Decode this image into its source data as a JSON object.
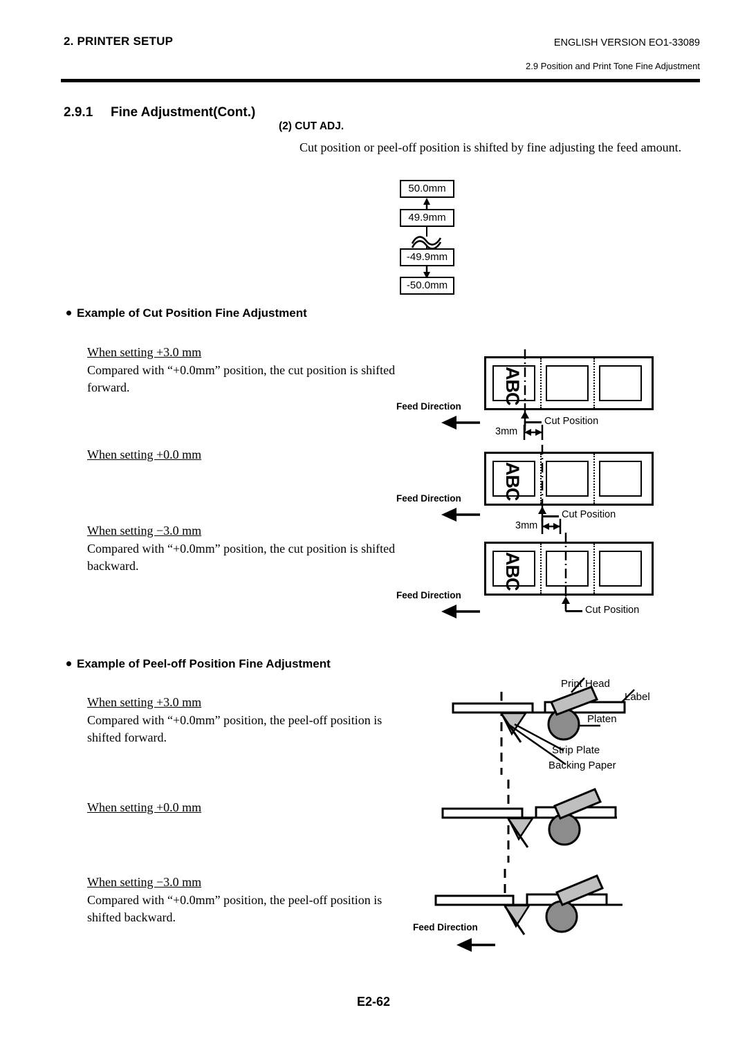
{
  "header": {
    "chapter": "2. PRINTER SETUP",
    "version": "ENGLISH VERSION EO1-33089",
    "subsection": "2.9 Position and Print Tone Fine Adjustment"
  },
  "section": {
    "number": "2.9.1",
    "title": "Fine Adjustment(Cont.)",
    "item_heading": "(2) CUT ADJ.",
    "item_body": "Cut position or peel-off position is shifted by fine adjusting the feed amount."
  },
  "range_boxes": {
    "max": "50.0mm",
    "near_max": "49.9mm",
    "near_min": "-49.9mm",
    "min": "-50.0mm"
  },
  "cut_section": {
    "heading": "Example of Cut Position Fine Adjustment",
    "cases": [
      {
        "setting": "When setting +3.0 mm",
        "line1": "Compared with “+0.0mm” position, the cut position",
        "line2": "is shifted forward."
      },
      {
        "setting": "When setting +0.0 mm",
        "line1": "",
        "line2": ""
      },
      {
        "setting": "When setting −3.0 mm",
        "line1": "Compared with “+0.0mm” position, the cut position",
        "line2": "is shifted backward."
      }
    ],
    "diagram_labels": {
      "feed_direction": "Feed Direction",
      "cut_position": "Cut Position",
      "dimension": "3mm",
      "label_text": "ABC"
    }
  },
  "peel_section": {
    "heading": "Example of Peel-off Position Fine Adjustment",
    "cases": [
      {
        "setting": "When setting +3.0 mm",
        "line1": "Compared with “+0.0mm” position, the peel-off",
        "line2": "position is shifted forward."
      },
      {
        "setting": "When setting +0.0 mm",
        "line1": "",
        "line2": ""
      },
      {
        "setting": "When setting −3.0 mm",
        "line1": "Compared with “+0.0mm” position, the peel-off",
        "line2": "position is shifted backward."
      }
    ],
    "diagram_labels": {
      "print_head": "Print Head",
      "label": "Label",
      "platen": "Platen",
      "strip_plate": "Strip Plate",
      "backing_paper": "Backing Paper",
      "feed_direction": "Feed Direction"
    }
  },
  "footer": {
    "page": "E2-62"
  },
  "colors": {
    "ink": "#000000",
    "paper": "#ffffff",
    "gray_part": "#8c8c8c",
    "gray_light": "#bfbfbf"
  }
}
